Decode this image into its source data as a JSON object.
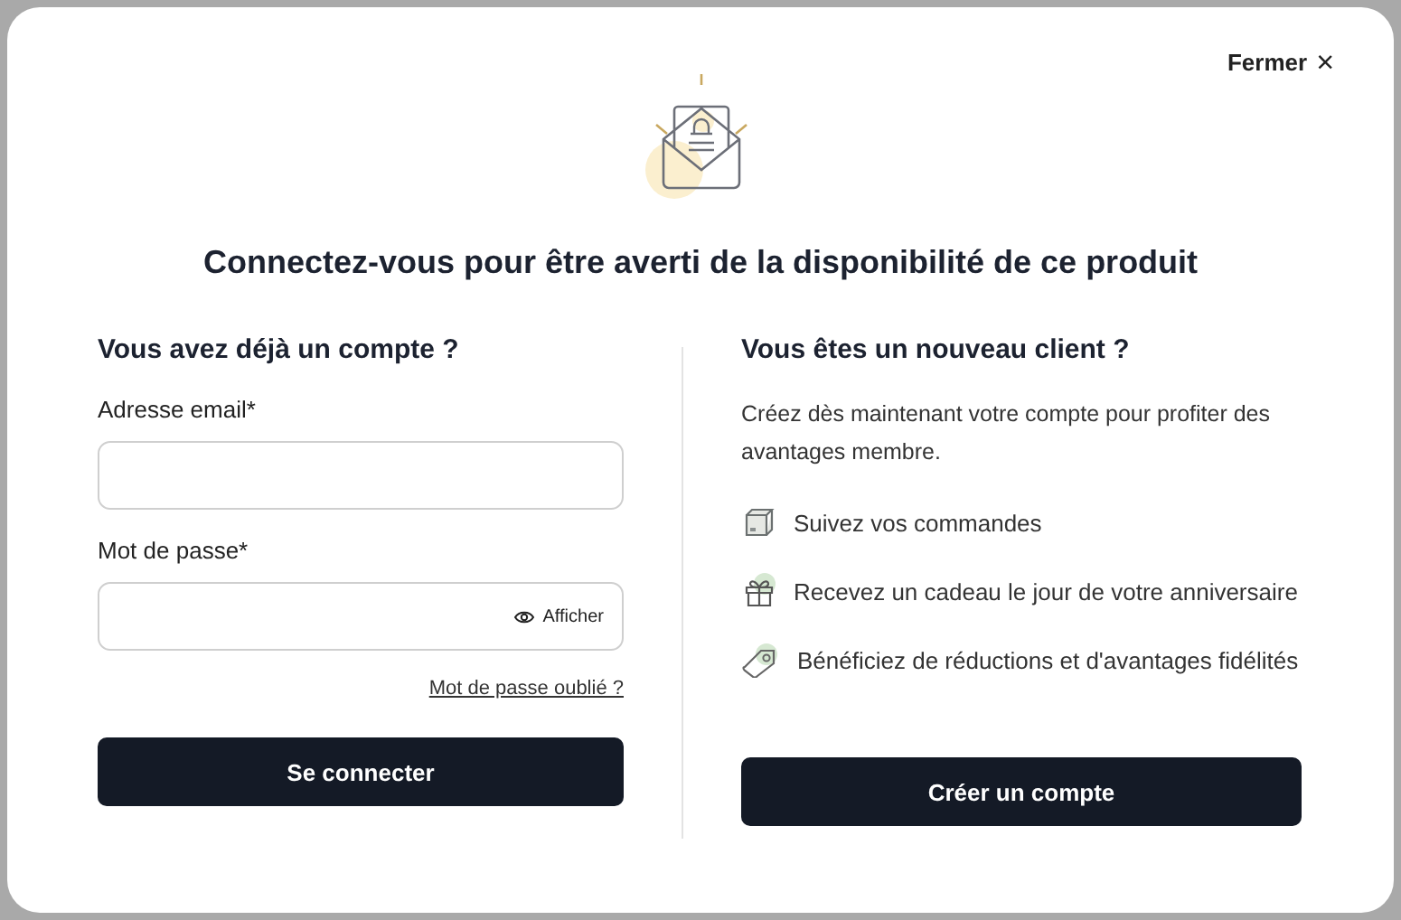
{
  "close": {
    "label": "Fermer",
    "glyph": "×"
  },
  "title": "Connectez-vous pour être averti de la disponibilité de ce produit",
  "login": {
    "heading": "Vous avez déjà un compte ?",
    "email_field": {
      "label": "Adresse email*"
    },
    "password_field": {
      "label": "Mot de passe*",
      "toggle": "Afficher"
    },
    "forgot_link": "Mot de passe oublié ?",
    "submit": "Se connecter"
  },
  "signup": {
    "heading": "Vous êtes un nouveau client ?",
    "intro": "Créez dès maintenant votre compte pour profiter des avantages membre.",
    "benefits": [
      {
        "kind": "box",
        "text": "Suivez vos commandes"
      },
      {
        "kind": "gift",
        "text": "Recevez un cadeau le jour de votre anniversaire"
      },
      {
        "kind": "tag",
        "text": "Bénéficiez de réductions et d'avantages fidélités"
      }
    ],
    "submit": "Créer un compte"
  }
}
